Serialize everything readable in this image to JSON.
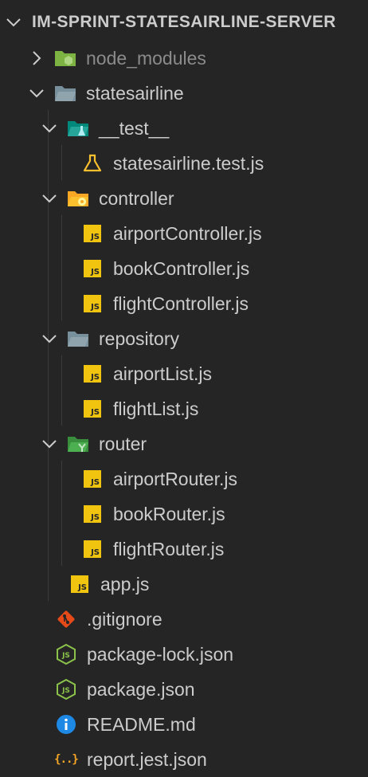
{
  "explorer": {
    "project_title": "IM-SPRINT-STATESAIRLINE-SERVER",
    "items": [
      {
        "label": "node_modules"
      },
      {
        "label": "statesairline"
      },
      {
        "label": "__test__"
      },
      {
        "label": "statesairline.test.js"
      },
      {
        "label": "controller"
      },
      {
        "label": "airportController.js"
      },
      {
        "label": "bookController.js"
      },
      {
        "label": "flightController.js"
      },
      {
        "label": "repository"
      },
      {
        "label": "airportList.js"
      },
      {
        "label": "flightList.js"
      },
      {
        "label": "router"
      },
      {
        "label": "airportRouter.js"
      },
      {
        "label": "bookRouter.js"
      },
      {
        "label": "flightRouter.js"
      },
      {
        "label": "app.js"
      },
      {
        "label": ".gitignore"
      },
      {
        "label": "package-lock.json"
      },
      {
        "label": "package.json"
      },
      {
        "label": "README.md"
      },
      {
        "label": "report.jest.json"
      }
    ],
    "js_badge": "JS",
    "json_badge": "{..}",
    "colors": {
      "background": "#252526",
      "text": "#cccccc",
      "dim_text": "#8b8b8b",
      "js_yellow": "#f1c40f",
      "node_green": "#8bc34a",
      "folder_gray": "#90a4ae",
      "test_teal": "#26a69a",
      "controller_yellow": "#fbc02d",
      "router_green": "#43a047",
      "git_orange": "#e64a19",
      "info_blue": "#1e88e5"
    }
  }
}
